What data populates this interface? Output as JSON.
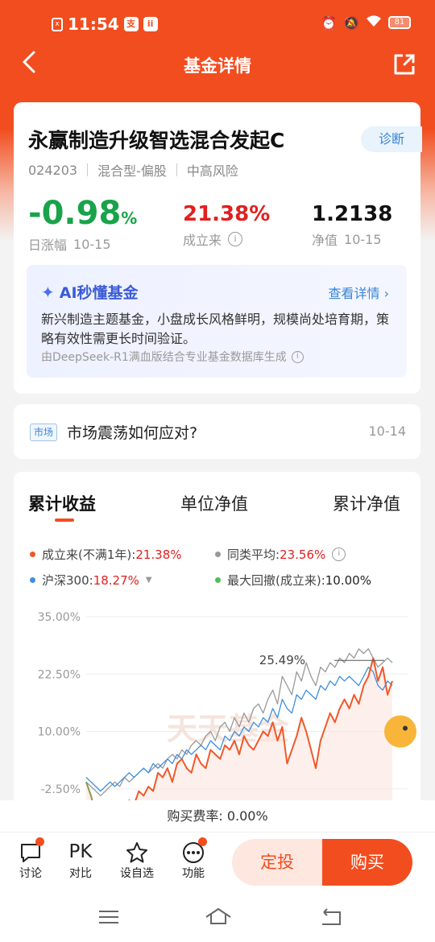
{
  "status_bar": {
    "time": "11:54",
    "battery": "81",
    "icon1": "支",
    "icon2": "ii"
  },
  "nav": {
    "title": "基金详情"
  },
  "fund": {
    "name": "永赢制造升级智选混合发起C",
    "diagnose_label": "诊断",
    "code": "024203",
    "category": "混合型-偏股",
    "risk": "中高风险",
    "daily_change": "-0.98",
    "daily_change_unit": "%",
    "daily_change_label": "日涨幅",
    "daily_change_date": "10-15",
    "since_inception": "21.38%",
    "since_inception_label": "成立来",
    "nav_value": "1.2138",
    "nav_label": "净值",
    "nav_date": "10-15"
  },
  "ai": {
    "title": "AI秒懂基金",
    "more": "查看详情",
    "description": "新兴制造主题基金，小盘成长风格鲜明，规模尚处培育期，策略有效性需更长时间验证。",
    "source": "由DeepSeek-R1满血版结合专业基金数据库生成"
  },
  "market": {
    "tag": "市场",
    "text": "市场震荡如何应对?",
    "date": "10-14"
  },
  "tabs": [
    "累计收益",
    "单位净值",
    "累计净值"
  ],
  "legend": [
    {
      "label": "成立来(不满1年):",
      "value": "21.38%",
      "color": "#f0582a"
    },
    {
      "label": "同类平均:",
      "value": "23.56%",
      "color": "#999999"
    },
    {
      "label": "沪深300:",
      "value": "18.27%",
      "color": "#3d8fe0"
    },
    {
      "label": "最大回撤(成立来):",
      "value": "10.00%",
      "color": "#4cc05a"
    }
  ],
  "chart_data": {
    "type": "line",
    "y_ticks": [
      "35.00%",
      "22.50%",
      "10.00%",
      "-2.50%"
    ],
    "ylim": [
      -5,
      35
    ],
    "annotation": "25.49%",
    "watermark": "天天基金",
    "series": [
      {
        "name": "成立来(不满1年)",
        "color": "#f0582a",
        "values": [
          -1,
          -4,
          -8,
          -11,
          -9,
          -10,
          -7,
          -6,
          -8,
          -5,
          -6,
          -3,
          -4,
          -2,
          -3,
          1,
          0,
          2,
          -1,
          3,
          4,
          2,
          1,
          5,
          3,
          2,
          6,
          5,
          4,
          7,
          6,
          8,
          5,
          9,
          7,
          6,
          8,
          10,
          9,
          12,
          8,
          11,
          3,
          6,
          9,
          13,
          10,
          6,
          2,
          8,
          11,
          14,
          12,
          15,
          17,
          15,
          18,
          16,
          20,
          22,
          26,
          21,
          24,
          18,
          21
        ]
      },
      {
        "name": "同类平均",
        "color": "#999999",
        "values": [
          -1,
          -2,
          -3,
          -4,
          -3,
          -2,
          -1,
          -2,
          0,
          -1,
          0,
          1,
          2,
          1,
          2,
          3,
          2,
          4,
          5,
          4,
          6,
          5,
          7,
          8,
          7,
          9,
          10,
          8,
          11,
          12,
          10,
          13,
          11,
          14,
          12,
          15,
          16,
          14,
          17,
          19,
          16,
          22,
          20,
          18,
          23,
          21,
          25,
          22,
          20,
          24,
          23,
          25,
          24,
          26,
          25,
          27,
          26,
          28,
          27,
          28,
          26,
          24,
          25,
          26,
          25
        ]
      },
      {
        "name": "沪深300",
        "color": "#3d8fe0",
        "values": [
          0,
          -1,
          -2,
          -3,
          -2,
          -1,
          -2,
          -1,
          0,
          1,
          0,
          1,
          2,
          1,
          3,
          2,
          3,
          4,
          3,
          5,
          4,
          6,
          5,
          6,
          7,
          6,
          8,
          7,
          6,
          9,
          8,
          10,
          9,
          11,
          10,
          12,
          11,
          13,
          12,
          15,
          13,
          17,
          15,
          14,
          18,
          17,
          19,
          18,
          17,
          20,
          19,
          21,
          20,
          22,
          21,
          22,
          21,
          20,
          22,
          24,
          23,
          20,
          19,
          21,
          20
        ]
      },
      {
        "name": "最大回撤(成立来)",
        "color": "#4cc05a",
        "values": [
          -1,
          -4,
          -8,
          -11
        ]
      }
    ]
  },
  "fee": "购买费率: 0.00%",
  "bottom": {
    "discuss": "讨论",
    "pk_icon": "PK",
    "compare": "对比",
    "watchlist": "设自选",
    "functions": "功能",
    "auto_invest": "定投",
    "buy": "购买"
  }
}
